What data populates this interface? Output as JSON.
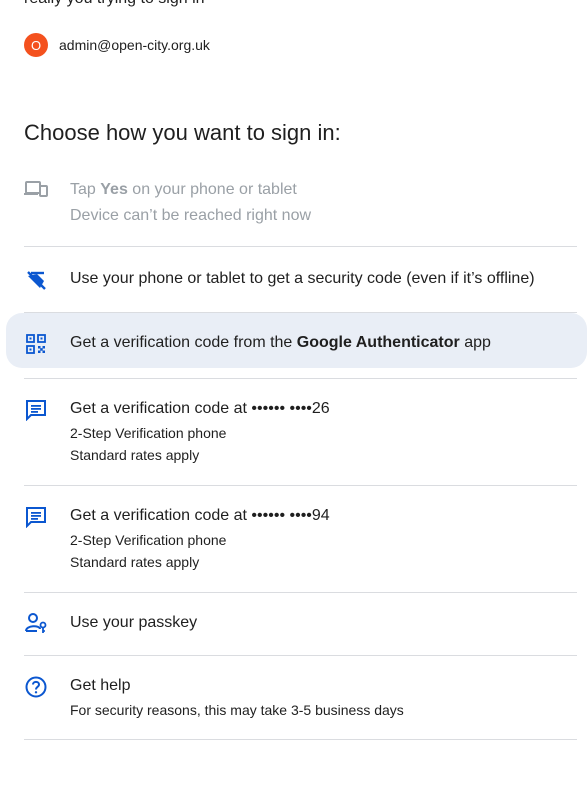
{
  "top_text": "really you trying to sign in",
  "account": {
    "avatar_letter": "O",
    "email": "admin@open-city.org.uk"
  },
  "heading": "Choose how you want to sign in:",
  "options": [
    {
      "title_pre": "Tap ",
      "title_bold": "Yes",
      "title_post": " on your phone or tablet",
      "sub": "Device can’t be reached right now",
      "icon": "devices-icon",
      "disabled": true
    },
    {
      "title": "Use your phone or tablet to get a security code (even if it’s offline)",
      "icon": "phonelink-off-icon"
    },
    {
      "title_pre": "Get a verification code from the ",
      "title_bold": "Google Authenticator",
      "title_post": " app",
      "icon": "qr-code-icon",
      "highlighted": true
    },
    {
      "title": "Get a verification code at •••••• ••••26",
      "sub1": "2-Step Verification phone",
      "sub2": "Standard rates apply",
      "icon": "message-icon"
    },
    {
      "title": "Get a verification code at •••••• ••••94",
      "sub1": "2-Step Verification phone",
      "sub2": "Standard rates apply",
      "icon": "message-icon"
    },
    {
      "title": "Use your passkey",
      "icon": "passkey-icon"
    },
    {
      "title": "Get help",
      "sub": "For security reasons, this may take 3-5 business days",
      "icon": "help-icon"
    }
  ],
  "colors": {
    "accent": "#0b57d0",
    "disabled": "#9aa0a6",
    "avatar": "#f4511e",
    "highlight": "#e9eef6",
    "divider": "#dadce0"
  }
}
